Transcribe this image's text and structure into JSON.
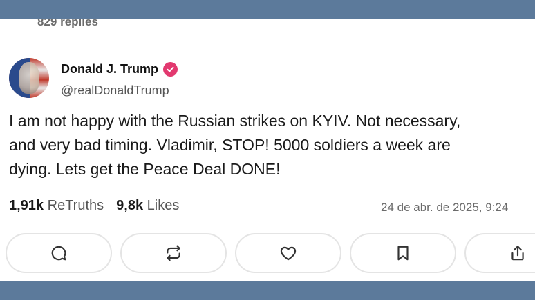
{
  "post": {
    "replies": "829 replies",
    "author_name": "Donald J. Trump",
    "author_handle": "@realDonaldTrump",
    "text": "I am not happy with the Russian strikes on KYIV. Not necessary,\nand very bad timing. Vladimir, STOP! 5000 soldiers a week are\ndying. Lets get the Peace Deal DONE!",
    "retruths_count": "1,91k",
    "retruths_label": "ReTruths",
    "likes_count": "9,8k",
    "likes_label": "Likes",
    "timestamp": "24 de abr. de 2025, 9:24"
  },
  "actions": [
    {
      "icon": "reply-icon"
    },
    {
      "icon": "retruth-icon"
    },
    {
      "icon": "heart-icon"
    },
    {
      "icon": "bookmark-icon"
    },
    {
      "icon": "share-icon"
    }
  ],
  "colors": {
    "verified_badge": "#e2396f",
    "frame_background": "#5c7a9b"
  }
}
